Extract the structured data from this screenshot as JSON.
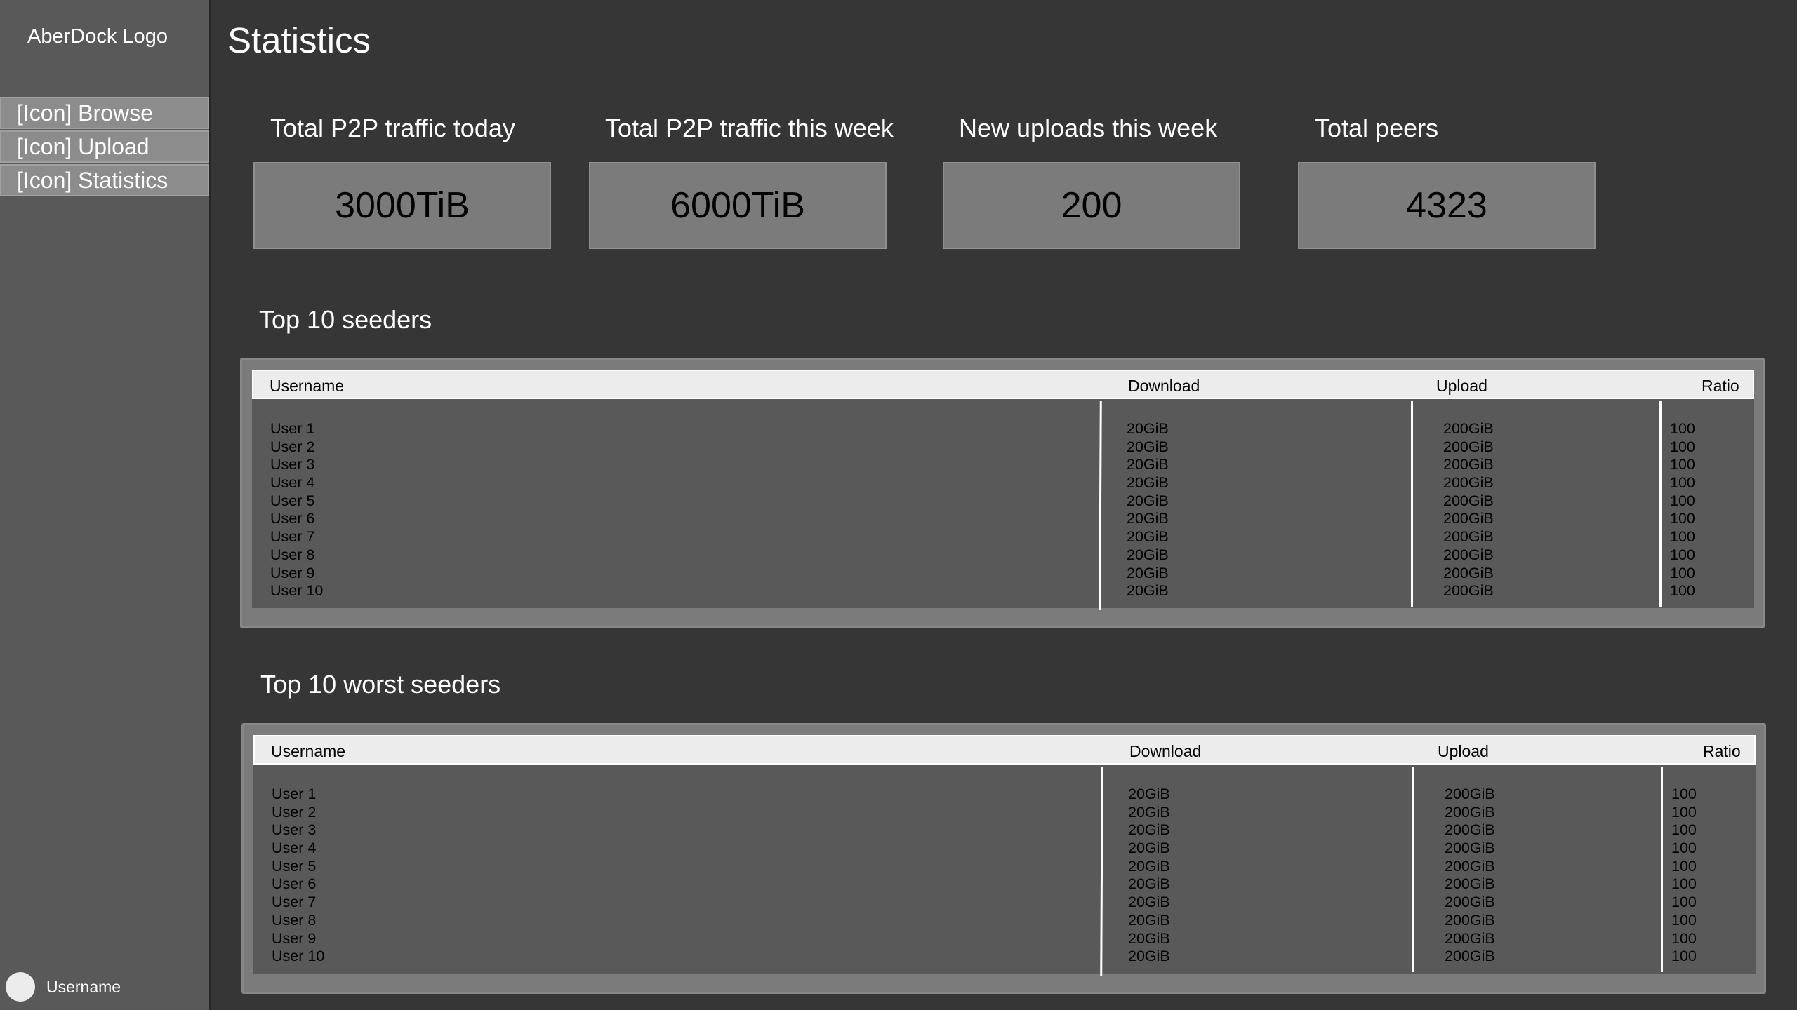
{
  "sidebar": {
    "logo": "AberDock Logo",
    "items": [
      {
        "label": "[Icon] Browse"
      },
      {
        "label": "[Icon] Upload"
      },
      {
        "label": "[Icon] Statistics"
      }
    ],
    "user": {
      "name": "Username"
    }
  },
  "page": {
    "title": "Statistics"
  },
  "stats": [
    {
      "label": "Total P2P traffic today",
      "value": "3000TiB"
    },
    {
      "label": "Total P2P traffic this week",
      "value": "6000TiB"
    },
    {
      "label": "New uploads this week",
      "value": "200"
    },
    {
      "label": "Total peers",
      "value": "4323"
    }
  ],
  "tables": [
    {
      "title": "Top 10 seeders",
      "headers": {
        "username": "Username",
        "download": "Download",
        "upload": "Upload",
        "ratio": "Ratio"
      },
      "rows": [
        {
          "username": "User 1",
          "download": "20GiB",
          "upload": "200GiB",
          "ratio": "100"
        },
        {
          "username": "User 2",
          "download": "20GiB",
          "upload": "200GiB",
          "ratio": "100"
        },
        {
          "username": "User 3",
          "download": "20GiB",
          "upload": "200GiB",
          "ratio": "100"
        },
        {
          "username": "User 4",
          "download": "20GiB",
          "upload": "200GiB",
          "ratio": "100"
        },
        {
          "username": "User 5",
          "download": "20GiB",
          "upload": "200GiB",
          "ratio": "100"
        },
        {
          "username": "User 6",
          "download": "20GiB",
          "upload": "200GiB",
          "ratio": "100"
        },
        {
          "username": "User 7",
          "download": "20GiB",
          "upload": "200GiB",
          "ratio": "100"
        },
        {
          "username": "User 8",
          "download": "20GiB",
          "upload": "200GiB",
          "ratio": "100"
        },
        {
          "username": "User 9",
          "download": "20GiB",
          "upload": "200GiB",
          "ratio": "100"
        },
        {
          "username": "User 10",
          "download": "20GiB",
          "upload": "200GiB",
          "ratio": "100"
        }
      ]
    },
    {
      "title": "Top 10 worst seeders",
      "headers": {
        "username": "Username",
        "download": "Download",
        "upload": "Upload",
        "ratio": "Ratio"
      },
      "rows": [
        {
          "username": "User 1",
          "download": "20GiB",
          "upload": "200GiB",
          "ratio": "100"
        },
        {
          "username": "User 2",
          "download": "20GiB",
          "upload": "200GiB",
          "ratio": "100"
        },
        {
          "username": "User 3",
          "download": "20GiB",
          "upload": "200GiB",
          "ratio": "100"
        },
        {
          "username": "User 4",
          "download": "20GiB",
          "upload": "200GiB",
          "ratio": "100"
        },
        {
          "username": "User 5",
          "download": "20GiB",
          "upload": "200GiB",
          "ratio": "100"
        },
        {
          "username": "User 6",
          "download": "20GiB",
          "upload": "200GiB",
          "ratio": "100"
        },
        {
          "username": "User 7",
          "download": "20GiB",
          "upload": "200GiB",
          "ratio": "100"
        },
        {
          "username": "User 8",
          "download": "20GiB",
          "upload": "200GiB",
          "ratio": "100"
        },
        {
          "username": "User 9",
          "download": "20GiB",
          "upload": "200GiB",
          "ratio": "100"
        },
        {
          "username": "User 10",
          "download": "20GiB",
          "upload": "200GiB",
          "ratio": "100"
        }
      ]
    }
  ]
}
